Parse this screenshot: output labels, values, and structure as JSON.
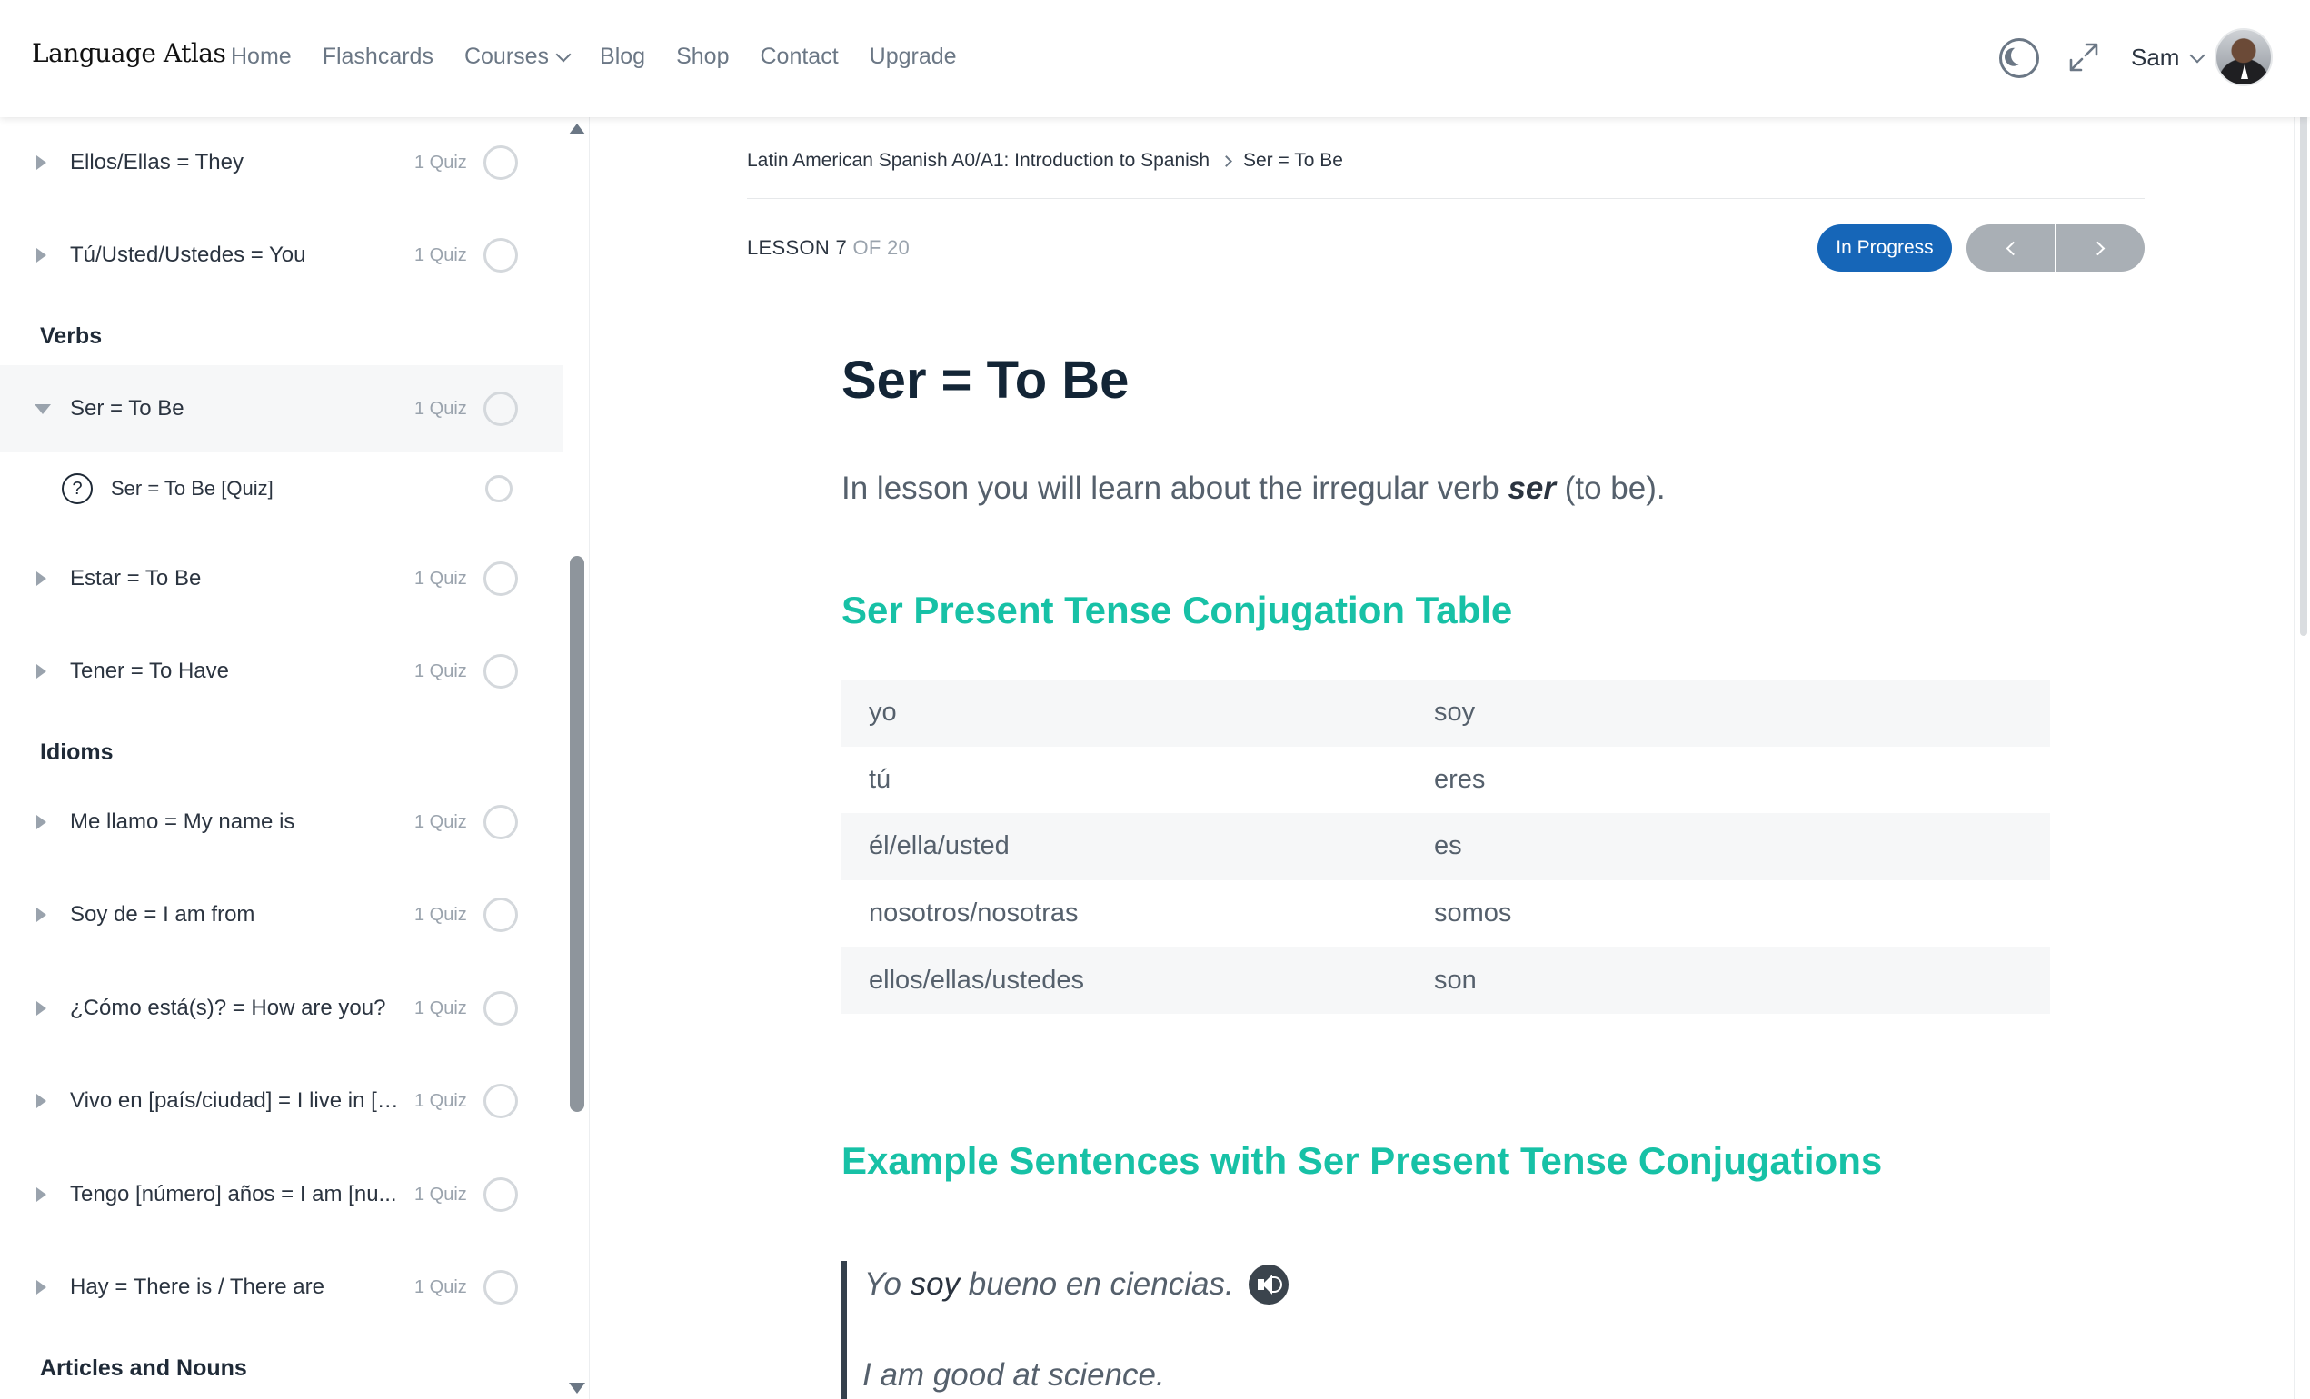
{
  "header": {
    "logo": "Language Atlas",
    "nav": [
      "Home",
      "Flashcards",
      "Courses",
      "Blog",
      "Shop",
      "Contact",
      "Upgrade"
    ],
    "user_name": "Sam"
  },
  "sidebar": {
    "rows": [
      {
        "label": "Ellos/Ellas = They",
        "meta": "1 Quiz"
      },
      {
        "label": "Tú/Usted/Ustedes = You",
        "meta": "1 Quiz"
      },
      {
        "label": "Ser = To Be",
        "meta": "1 Quiz"
      },
      {
        "label": "Estar = To Be",
        "meta": "1 Quiz"
      },
      {
        "label": "Tener = To Have",
        "meta": "1 Quiz"
      },
      {
        "label": "Me llamo = My name is",
        "meta": "1 Quiz"
      },
      {
        "label": "Soy de = I am from",
        "meta": "1 Quiz"
      },
      {
        "label": "¿Cómo está(s)? = How are you?",
        "meta": "1 Quiz"
      },
      {
        "label": "Vivo en [país/ciudad] = I live in [c...",
        "meta": "1 Quiz"
      },
      {
        "label": "Tengo [número] años = I am [nu...",
        "meta": "1 Quiz"
      },
      {
        "label": "Hay = There is / There are",
        "meta": "1 Quiz"
      }
    ],
    "sections": [
      "Verbs",
      "Idioms",
      "Articles and Nouns"
    ],
    "sub_item": {
      "icon_char": "?",
      "label": "Ser = To Be [Quiz]"
    }
  },
  "main": {
    "breadcrumb": [
      "Latin American Spanish A0/A1: Introduction to Spanish",
      "Ser = To Be"
    ],
    "lesson_label": "LESSON 7",
    "lesson_of": "OF 20",
    "status_button": "In Progress",
    "title": "Ser = To Be",
    "intro_before": "In lesson you will learn about the irregular verb ",
    "intro_bold": "ser",
    "intro_after": " (to be).",
    "heading_table": "Ser Present Tense Conjugation Table",
    "conjugations": [
      {
        "pronoun": "yo",
        "form": "soy"
      },
      {
        "pronoun": "tú",
        "form": "eres"
      },
      {
        "pronoun": "él/ella/usted",
        "form": "es"
      },
      {
        "pronoun": "nosotros/nosotras",
        "form": "somos"
      },
      {
        "pronoun": "ellos/ellas/ustedes",
        "form": "son"
      }
    ],
    "heading_examples": "Example Sentences with Ser Present Tense Conjugations",
    "example": {
      "pre": "Yo ",
      "bold": "soy",
      "post": " bueno en ciencias.",
      "translation": "I am good at science."
    }
  }
}
